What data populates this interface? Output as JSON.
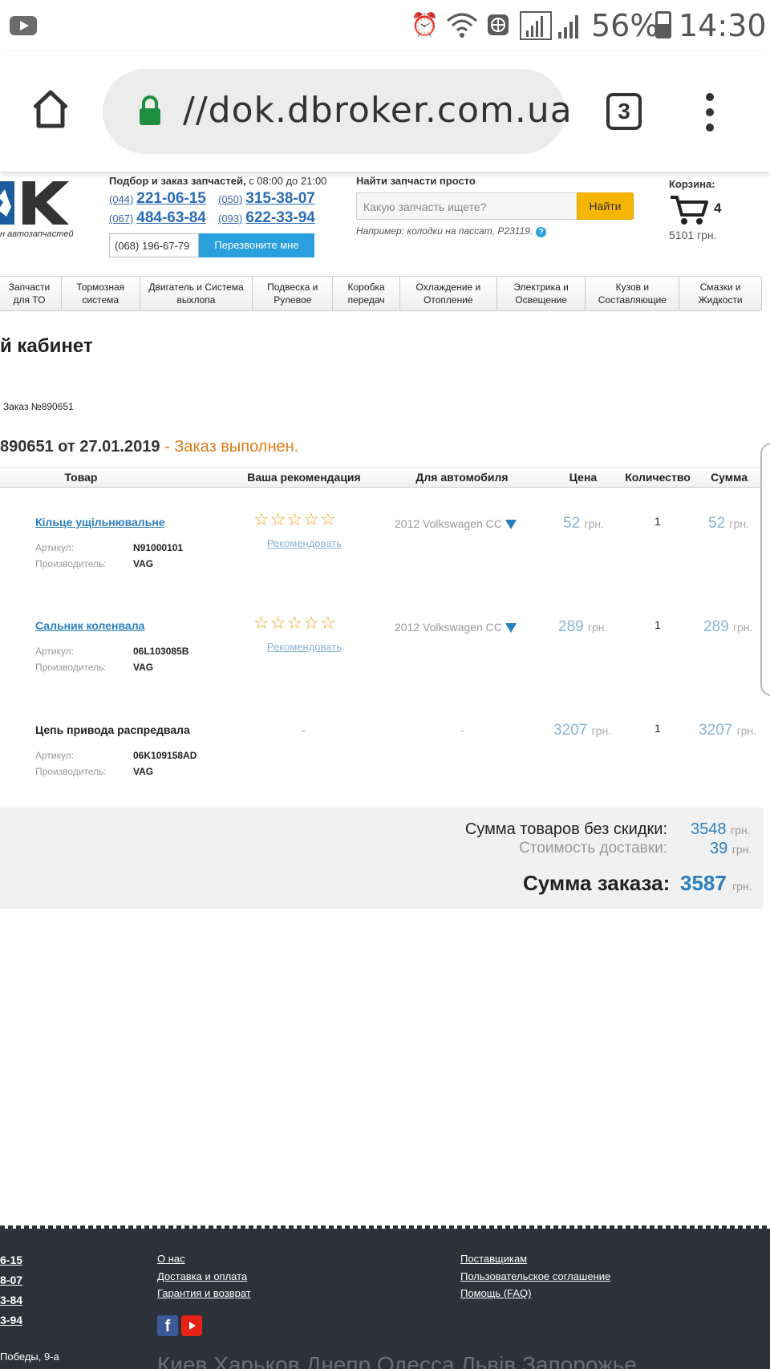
{
  "status_bar": {
    "battery": "56%",
    "time": "14:30"
  },
  "browser": {
    "url": "//dok.dbroker.com.ua",
    "tab_count": "3"
  },
  "header": {
    "logo_text": "OK",
    "logo_subtitle": "н автозапчастей",
    "hours_bold": "Подбор и заказ запчастей,",
    "hours_rest": "с 08:00 до 21:00",
    "phones": [
      {
        "code": "(044)",
        "number": "221-06-15"
      },
      {
        "code": "(050)",
        "number": "315-38-07"
      },
      {
        "code": "(067)",
        "number": "484-63-84"
      },
      {
        "code": "(093)",
        "number": "622-33-94"
      }
    ],
    "callback_phone": "(068) 196-67-79",
    "callback_button": "Перезвоните мне",
    "search_title": "Найти запчасти просто",
    "search_placeholder": "Какую запчасть ищете?",
    "search_button": "Найти",
    "search_hint": "Например: колодки на пассат, P23119.",
    "cart_label": "Корзина:",
    "cart_count": "4",
    "cart_sum": "5101 грн."
  },
  "nav": [
    "Запчасти для ТО",
    "Тормозная система",
    "Двигатель и Система выхлопа",
    "Подвеска и Рулевое",
    "Коробка передач",
    "Охлаждение и Отопление",
    "Электрика и Освещение",
    "Кузов и Составляющие",
    "Смазки и Жидкости"
  ],
  "page": {
    "title": "й кабинет",
    "breadcrumb": "Заказ №890651",
    "order_heading": "890651 от 27.01.2019",
    "order_sep": "-",
    "order_status": "Заказ выполнен."
  },
  "table": {
    "headers": [
      "Товар",
      "Ваша рекомендация",
      "Для автомобиля",
      "Цена",
      "Количество",
      "Сумма"
    ],
    "article_label": "Артикул:",
    "maker_label": "Производитель:",
    "recommend_label": "Рекомендовать",
    "currency": "грн.",
    "stars": "☆☆☆☆☆",
    "rows": [
      {
        "name": "Кільце ущільнювальне",
        "article": "N91000101",
        "maker": "VAG",
        "car": "2012 Volkswagen CC",
        "price": "52",
        "qty": "1",
        "sum": "52"
      },
      {
        "name": "Сальник коленвала",
        "article": "06L103085B",
        "maker": "VAG",
        "car": "2012 Volkswagen CC",
        "price": "289",
        "qty": "1",
        "sum": "289"
      },
      {
        "name": "Цепь привода распредвала",
        "article": "06K109158AD",
        "maker": "VAG",
        "rec_dash": "-",
        "car_dash": "-",
        "price": "3207",
        "qty": "1",
        "sum": "3207"
      }
    ]
  },
  "summary": {
    "goods_label": "Сумма товаров без скидки:",
    "goods_value": "3548",
    "delivery_label": "Стоимость доставки:",
    "delivery_value": "39",
    "total_label": "Сумма заказа:",
    "total_value": "3587",
    "currency": "грн."
  },
  "footer": {
    "phones": [
      "6-15",
      "8-07",
      "3-84",
      "3-94"
    ],
    "links_col1": [
      "О нас",
      "Доставка и оплата",
      "Гарантия и возврат"
    ],
    "links_col2": [
      "Поставщикам",
      "Пользовательское соглашение",
      "Помощь (FAQ)"
    ],
    "address": "Победы, 9-а",
    "cities": "Киев  Харьков  Днепр  Одесса  Львів  Запорожье"
  }
}
